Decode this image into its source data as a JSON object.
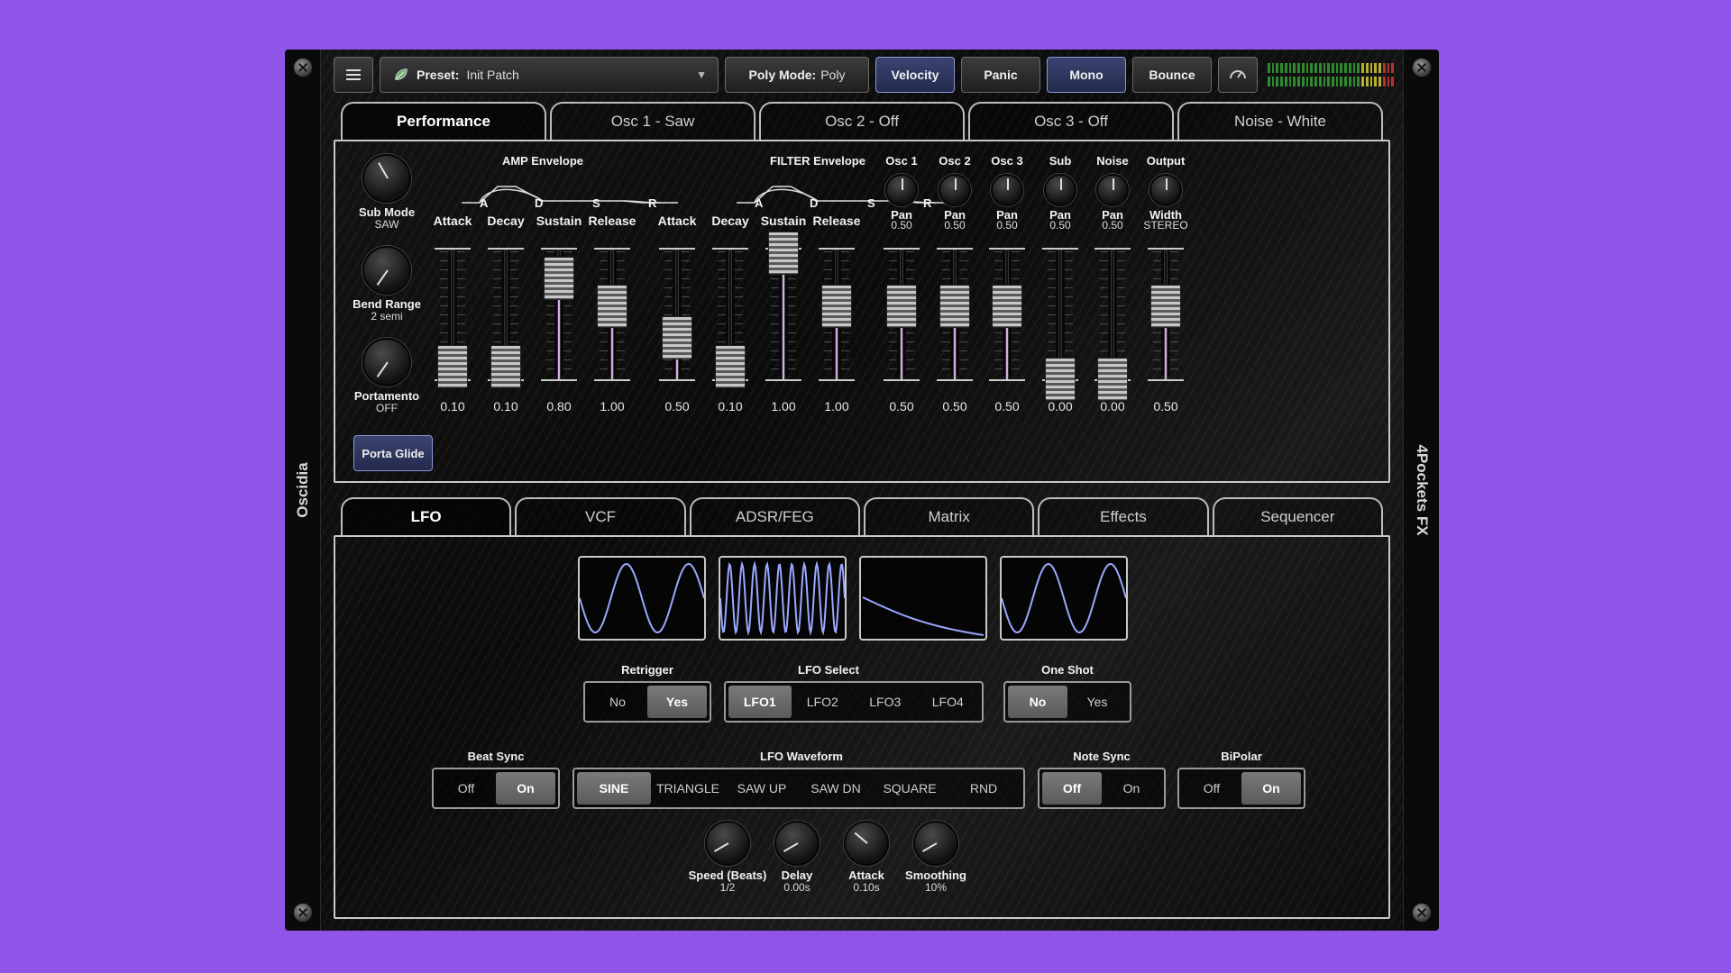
{
  "rails": {
    "left_label": "Oscidia",
    "right_label": "4Pockets FX"
  },
  "toolbar": {
    "preset_prefix": "Preset:",
    "preset_value": "Init Patch",
    "poly_prefix": "Poly Mode:",
    "poly_value": "Poly",
    "velocity": "Velocity",
    "panic": "Panic",
    "mono": "Mono",
    "bounce": "Bounce"
  },
  "top_tabs": [
    "Performance",
    "Osc 1 - Saw",
    "Osc 2 - Off",
    "Osc 3 - Off",
    "Noise - White"
  ],
  "performance": {
    "sub_mode": {
      "label": "Sub Mode",
      "value": "SAW"
    },
    "bend_range": {
      "label": "Bend Range",
      "value": "2 semi"
    },
    "portamento": {
      "label": "Portamento",
      "value": "OFF"
    },
    "porta_glide": "Porta Glide",
    "amp_envelope": {
      "title": "AMP Envelope",
      "stages": [
        "A",
        "D",
        "S",
        "R"
      ],
      "faders": [
        {
          "label": "Attack",
          "value": "0.10",
          "level": 0.1
        },
        {
          "label": "Decay",
          "value": "0.10",
          "level": 0.1
        },
        {
          "label": "Sustain",
          "value": "0.80",
          "level": 0.8
        },
        {
          "label": "Release",
          "value": "1.00",
          "level": 0.58
        }
      ]
    },
    "filter_envelope": {
      "title": "FILTER Envelope",
      "stages": [
        "A",
        "D",
        "S",
        "R"
      ],
      "faders": [
        {
          "label": "Attack",
          "value": "0.50",
          "level": 0.33
        },
        {
          "label": "Decay",
          "value": "0.10",
          "level": 0.1
        },
        {
          "label": "Sustain",
          "value": "1.00",
          "level": 1.0
        },
        {
          "label": "Release",
          "value": "1.00",
          "level": 0.58
        }
      ]
    },
    "mixer": [
      {
        "title": "Osc 1",
        "knob_label": "Pan",
        "knob_value": "0.50",
        "value": "0.50",
        "level": 0.58
      },
      {
        "title": "Osc 2",
        "knob_label": "Pan",
        "knob_value": "0.50",
        "value": "0.50",
        "level": 0.58
      },
      {
        "title": "Osc 3",
        "knob_label": "Pan",
        "knob_value": "0.50",
        "value": "0.50",
        "level": 0.58
      },
      {
        "title": "Sub",
        "knob_label": "Pan",
        "knob_value": "0.50",
        "value": "0.00",
        "level": 0.0
      },
      {
        "title": "Noise",
        "knob_label": "Pan",
        "knob_value": "0.50",
        "value": "0.00",
        "level": 0.0
      },
      {
        "title": "Output",
        "knob_label": "Width",
        "knob_value": "STEREO",
        "value": "0.50",
        "level": 0.58
      }
    ]
  },
  "bottom_tabs": [
    "LFO",
    "VCF",
    "ADSR/FEG",
    "Matrix",
    "Effects",
    "Sequencer"
  ],
  "lfo": {
    "retrigger": {
      "label": "Retrigger",
      "options": [
        "No",
        "Yes"
      ],
      "selected": 1
    },
    "lfo_select": {
      "label": "LFO Select",
      "options": [
        "LFO1",
        "LFO2",
        "LFO3",
        "LFO4"
      ],
      "selected": 0
    },
    "one_shot": {
      "label": "One Shot",
      "options": [
        "No",
        "Yes"
      ],
      "selected": 0
    },
    "beat_sync": {
      "label": "Beat Sync",
      "options": [
        "Off",
        "On"
      ],
      "selected": 1
    },
    "waveform": {
      "label": "LFO Waveform",
      "options": [
        "SINE",
        "TRIANGLE",
        "SAW UP",
        "SAW DN",
        "SQUARE",
        "RND"
      ],
      "selected": 0
    },
    "note_sync": {
      "label": "Note Sync",
      "options": [
        "Off",
        "On"
      ],
      "selected": 0
    },
    "bipolar": {
      "label": "BiPolar",
      "options": [
        "Off",
        "On"
      ],
      "selected": 1
    },
    "knobs": [
      {
        "label": "Speed (Beats)",
        "value": "1/2"
      },
      {
        "label": "Delay",
        "value": "0.00s"
      },
      {
        "label": "Attack",
        "value": "0.10s"
      },
      {
        "label": "Smoothing",
        "value": "10%"
      }
    ]
  },
  "colors": {
    "accent": "#d9a8e8",
    "wave": "#9aa8ff",
    "background": "#8e55e8",
    "button_blue": "#3b4470"
  }
}
